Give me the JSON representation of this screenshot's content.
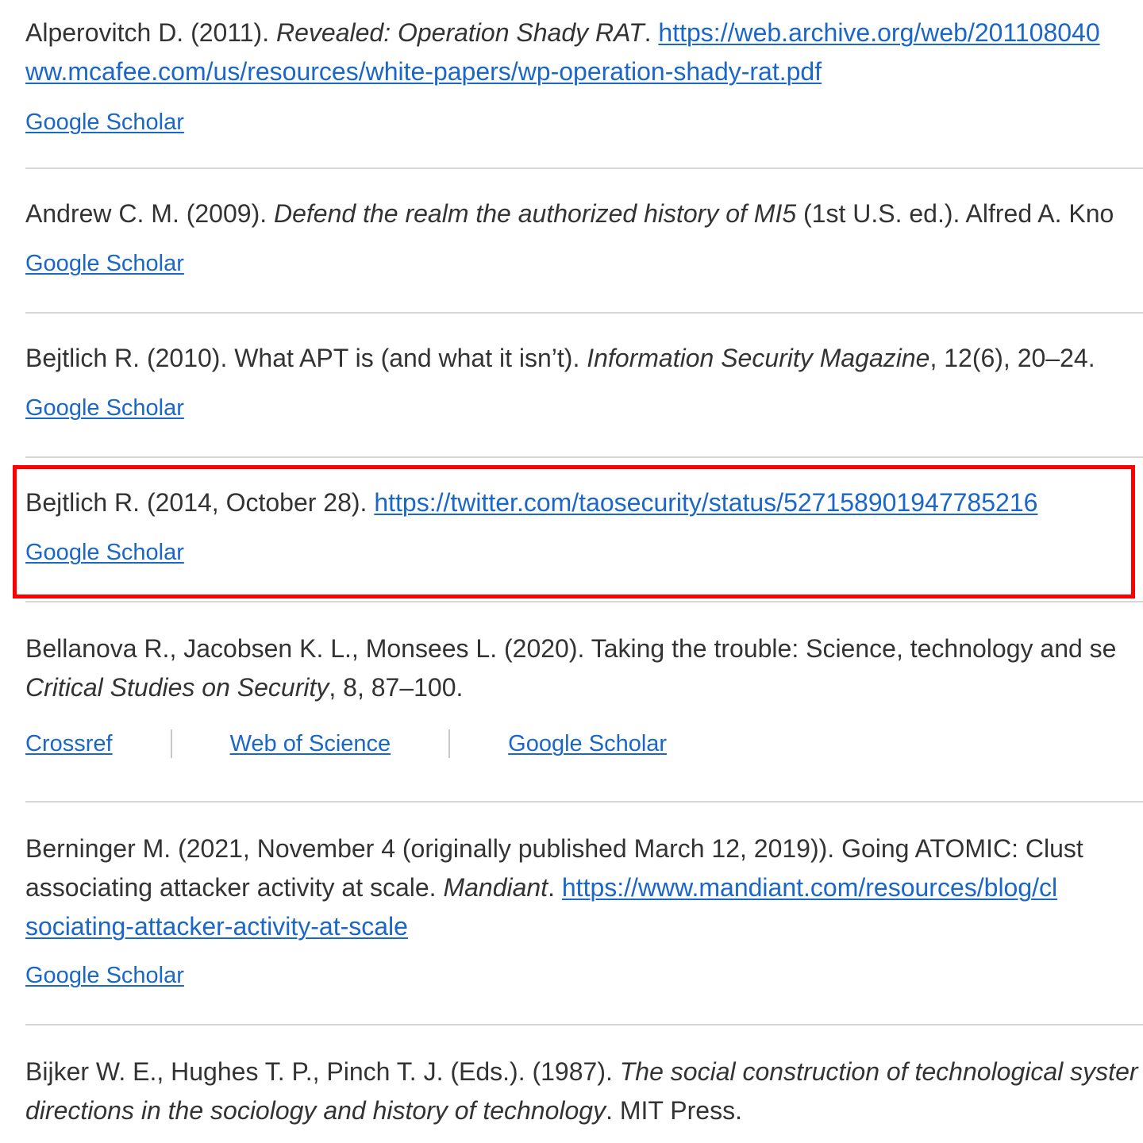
{
  "references": [
    {
      "authors_year": "Alperovitch D. (2011). ",
      "title_italic": "Revealed: Operation Shady RAT",
      "after_title": ". ",
      "url_line1": "https://web.archive.org/web/201108040",
      "url_line2": "ww.mcafee.com/us/resources/white-papers/wp-operation-shady-rat.pdf",
      "links": [
        "Google Scholar"
      ]
    },
    {
      "authors_year": "Andrew C. M. (2009). ",
      "title_italic": "Defend the realm the authorized history of MI5",
      "after_title": " (1st U.S. ed.). Alfred A. Kno",
      "links": [
        "Google Scholar"
      ]
    },
    {
      "authors_year": "Bejtlich R. (2010). What APT is (and what it isn’t). ",
      "title_italic": "Information Security Magazine",
      "after_title": ", 12(6), 20–24.",
      "links": [
        "Google Scholar"
      ]
    },
    {
      "authors_year": "Bejtlich R. (2014, October 28). ",
      "url_line1": "https://twitter.com/taosecurity/status/527158901947785216",
      "links": [
        "Google Scholar"
      ]
    },
    {
      "line1": "Bellanova R., Jacobsen K. L., Monsees L. (2020). Taking the trouble: Science, technology and se",
      "title_italic": "Critical Studies on Security",
      "after_title": ", 8, 87–100.",
      "links": [
        "Crossref",
        "Web of Science",
        "Google Scholar"
      ]
    },
    {
      "line1": "Berninger M. (2021, November 4 (originally published March 12, 2019)). Going ATOMIC: Clust",
      "line2_prefix": "associating attacker activity at scale. ",
      "journal_italic": "Mandiant",
      "after_journal": ". ",
      "url_line2": "https://www.mandiant.com/resources/blog/cl",
      "url_line3": "sociating-attacker-activity-at-scale",
      "links": [
        "Google Scholar"
      ]
    },
    {
      "line1_prefix": "Bijker W. E., Hughes T. P., Pinch T. J. (Eds.). (1987). ",
      "title_italic_line1": "The social construction of technological syster",
      "title_italic_line2": "directions in the sociology and history of technology",
      "after_title": ". MIT Press."
    }
  ],
  "colors": {
    "link": "#1a66c9",
    "text": "#333333",
    "divider": "#d6d6d6",
    "highlight": "#ff0000"
  }
}
